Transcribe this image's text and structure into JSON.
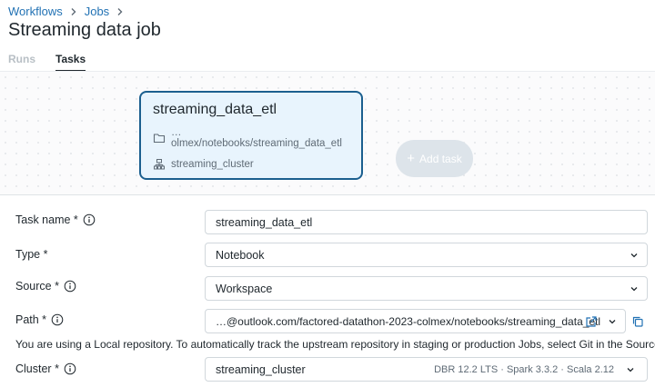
{
  "breadcrumb": {
    "items": [
      "Workflows",
      "Jobs"
    ]
  },
  "page": {
    "title": "Streaming data job"
  },
  "tabs": [
    {
      "label": "Runs",
      "active": false
    },
    {
      "label": "Tasks",
      "active": true
    }
  ],
  "canvas": {
    "task": {
      "name": "streaming_data_etl",
      "path": "…olmex/notebooks/streaming_data_etl",
      "cluster": "streaming_cluster"
    },
    "add_task_label": "Add task"
  },
  "form": {
    "task_name": {
      "label": "Task name *",
      "value": "streaming_data_etl"
    },
    "type": {
      "label": "Type *",
      "value": "Notebook"
    },
    "source": {
      "label": "Source *",
      "value": "Workspace"
    },
    "path": {
      "label": "Path *",
      "value": "…@outlook.com/factored-datathon-2023-colmex/notebooks/streaming_data_etl"
    },
    "hint": "You are using a Local repository. To automatically track the upstream repository in staging or production Jobs, select Git in the Source field.",
    "cluster": {
      "label": "Cluster *",
      "value": "streaming_cluster",
      "details": "DBR 12.2 LTS · Spark 3.3.2 · Scala 2.12"
    }
  },
  "colors": {
    "accent": "#2272b4",
    "card_border": "#1b5f8f",
    "card_bg": "#e8f4fd"
  }
}
